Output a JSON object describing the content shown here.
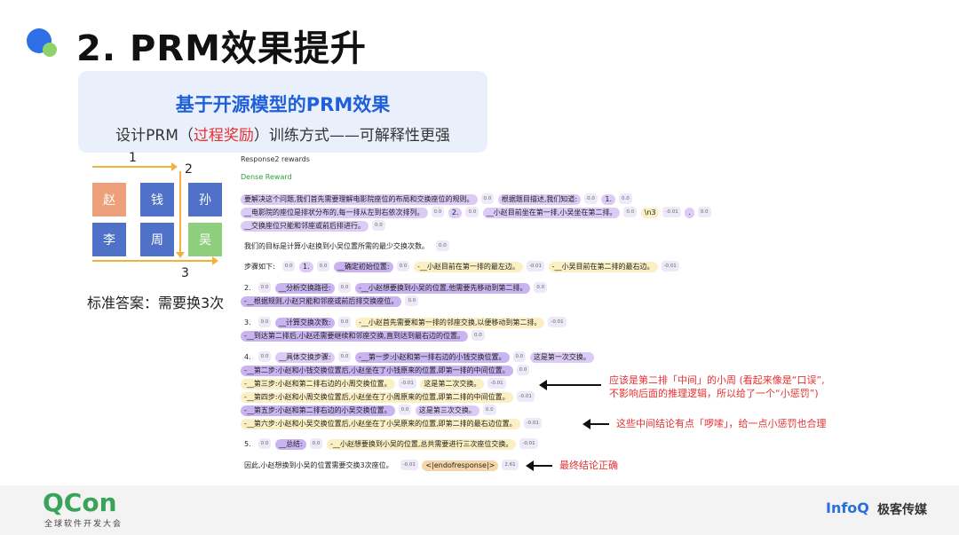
{
  "slide": {
    "title": "2. PRM效果提升",
    "header_main": "基于开源模型的PRM效果",
    "header_sub_before": "设计PRM（",
    "header_sub_highlight": "过程奖励",
    "header_sub_after": "）训练方式——可解释性更强"
  },
  "diagram": {
    "num1": "1",
    "num2": "2",
    "num3": "3",
    "seats": [
      {
        "label": "赵",
        "color": "#eda07a"
      },
      {
        "label": "钱",
        "color": "#4f72c8"
      },
      {
        "label": "孙",
        "color": "#4f72c8"
      },
      {
        "label": "李",
        "color": "#4f72c8"
      },
      {
        "label": "周",
        "color": "#4f72c8"
      },
      {
        "label": "吴",
        "color": "#8fce7c"
      }
    ],
    "answer": "标准答案：需要换3次"
  },
  "rewards": {
    "label": "Response2 rewards",
    "mode": "Dense Reward",
    "lines": {
      "l1a": "要解决这个问题,我们首先需要理解电影院座位的布局和交换座位的规则。",
      "l1b": "根据题目描述,我们知道:",
      "l1c": "1.",
      "l2a": "__电影院的座位是排状分布的,每一排从左到右依次排列。",
      "l2b": "2.",
      "l2c": "__小赵目前坐在第一排,小吴坐在第二排。",
      "l2d": "\\n3",
      "l2e": ".",
      "l3a": "__交换座位只能和邻座或前后排进行。",
      "l4a": "我们的目标是计算小赵换到小吴位置所需的最少交换次数。",
      "l5a": "步骤如下:",
      "l5b": "1.",
      "l5c": "__确定初始位置:",
      "l5d": "-__小赵目前在第一排的最左边。",
      "l5e": "-__小吴目前在第二排的最右边。",
      "l6a": "2.",
      "l6b": "__分析交换路径:",
      "l6c": "-__小赵想要换到小吴的位置,他需要先移动到第二排。",
      "l7a": "-__根据规则,小赵只能和邻座或前后排交换座位。",
      "l8a": "3.",
      "l8b": "__计算交换次数:",
      "l8c": "-__小赵首先需要和第一排的邻座交换,以便移动到第二排。",
      "l9a": "-__到达第二排后,小赵还需要继续和邻座交换,直到达到最右边的位置。",
      "l10a": "4.",
      "l10b": "__具体交换步骤:",
      "l10c": "-__第一步:小赵和第一排右边的小钱交换位置。",
      "l10d": "这是第一次交换。",
      "l11a": "-__第二步:小赵和小钱交换位置后,小赵坐在了小钱原来的位置,即第一排的中间位置。",
      "l12a": "-__第三步:小赵和第二排右边的小周交换位置。",
      "l12b": "这是第二次交换。",
      "l13a": "-__第四步:小赵和小周交换位置后,小赵坐在了小周原来的位置,即第二排的中间位置。",
      "l14a": "-__第五步:小赵和第二排右边的小吴交换位置。",
      "l14b": "这是第三次交换。",
      "l15a": "-__第六步:小赵和小吴交换位置后,小赵坐在了小吴原来的位置,即第二排的最右边位置。",
      "l16a": "5.",
      "l16b": "__总结:",
      "l16c": "-__小赵想要换到小吴的位置,总共需要进行三次座位交换。",
      "l17a": "因此,小赵想换到小吴的位置需要交换3次座位。",
      "l17b": "<|endofresponse|>"
    },
    "scores": {
      "s00": "0.0",
      "s01": "-0.01",
      "s261": "2.61"
    }
  },
  "annotations": {
    "a1_line1": "应该是第二排「中间」的小周 (看起来像是“口误”,",
    "a1_line2": "不影响后面的推理逻辑，所以给了一个“小惩罚”)",
    "a2": "这些中间结论有点「啰嗦」，给一点小惩罚也合理",
    "a3": "最终结论正确"
  },
  "footer": {
    "qcon": "QCon",
    "qcon_sub": "全球软件开发大会",
    "infoq": "InfoQ",
    "infoq_cn": "极客传媒"
  }
}
